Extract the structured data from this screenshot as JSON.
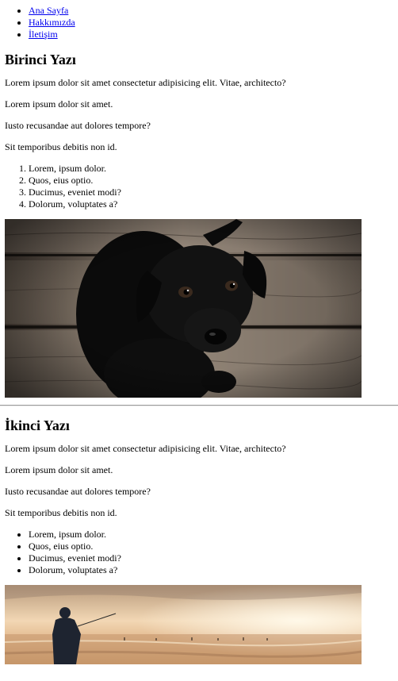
{
  "nav": {
    "items": [
      {
        "label": "Ana Sayfa"
      },
      {
        "label": "Hakkımızda"
      },
      {
        "label": "İletişim"
      }
    ]
  },
  "post1": {
    "title": "Birinci Yazı",
    "paragraphs": [
      "Lorem ipsum dolor sit amet consectetur adipisicing elit. Vitae, architecto?",
      "Lorem ipsum dolor sit amet.",
      "Iusto recusandae aut dolores tempore?",
      "Sit temporibus debitis non id."
    ],
    "list": [
      "Lorem, ipsum dolor.",
      "Quos, eius optio.",
      "Ducimus, eveniet modi?",
      "Dolorum, voluptates a?"
    ]
  },
  "post2": {
    "title": "İkinci Yazı",
    "paragraphs": [
      "Lorem ipsum dolor sit amet consectetur adipisicing elit. Vitae, architecto?",
      "Lorem ipsum dolor sit amet.",
      "Iusto recusandae aut dolores tempore?",
      "Sit temporibus debitis non id."
    ],
    "list": [
      "Lorem, ipsum dolor.",
      "Quos, eius optio.",
      "Ducimus, eveniet modi?",
      "Dolorum, voluptates a?"
    ]
  },
  "colors": {
    "link": "#0000ee",
    "separator": "#9a9a9a"
  }
}
